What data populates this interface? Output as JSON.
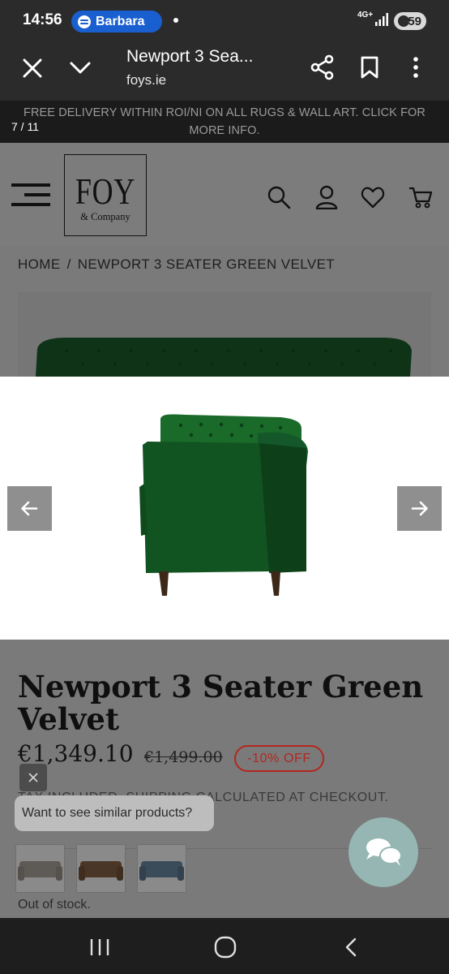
{
  "status_bar": {
    "time": "14:56",
    "media_user": "Barbara",
    "network": "4G+",
    "battery": "59"
  },
  "browser": {
    "title": "Newport 3 Sea...",
    "domain": "foys.ie"
  },
  "announcement": {
    "text": "FREE DELIVERY WITHIN ROI/NI ON ALL RUGS & WALL ART. CLICK FOR MORE INFO.",
    "gallery_counter": "7 / 11"
  },
  "logo": {
    "main": "FOY",
    "sub": "& Company"
  },
  "breadcrumb": {
    "home": "HOME",
    "separator": "/",
    "current": "NEWPORT 3 SEATER GREEN VELVET"
  },
  "product": {
    "title": "Newport 3 Seater Green Velvet",
    "price_now": "€1,349.10",
    "price_was": "€1,499.00",
    "discount": "-10% OFF",
    "tax_note": "TAX INCLUDED. SHIPPING CALCULATED AT CHECKOUT.",
    "stock": "Out of stock."
  },
  "recommendations": {
    "prompt": "Want to see similar products?"
  },
  "colors": {
    "sofa_green": "#0f4a1c",
    "discount_red": "#b3261e",
    "chat_teal": "#95b6b2",
    "pill_blue": "#1a5fd0"
  }
}
